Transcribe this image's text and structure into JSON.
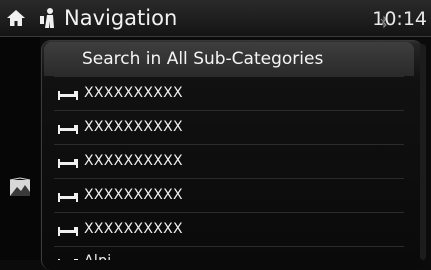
{
  "header": {
    "title": "Navigation",
    "time": "10:14",
    "home_icon": "home-icon",
    "poi_icon": "poi-icon"
  },
  "sidebar": {
    "map_icon": "map-view-icon"
  },
  "list": {
    "search_label": "Search in All Sub-Categories",
    "items": [
      {
        "label": "XXXXXXXXXX",
        "icon": "hotel-icon"
      },
      {
        "label": "XXXXXXXXXX",
        "icon": "hotel-icon"
      },
      {
        "label": "XXXXXXXXXX",
        "icon": "hotel-icon"
      },
      {
        "label": "XXXXXXXXXX",
        "icon": "hotel-icon"
      },
      {
        "label": "XXXXXXXXXX",
        "icon": "hotel-icon"
      },
      {
        "label": "Alpi...",
        "icon": "hotel-icon"
      }
    ]
  },
  "colors": {
    "background": "#0b0b0b",
    "text": "#f2f2f2",
    "selected_row": "#333333"
  }
}
